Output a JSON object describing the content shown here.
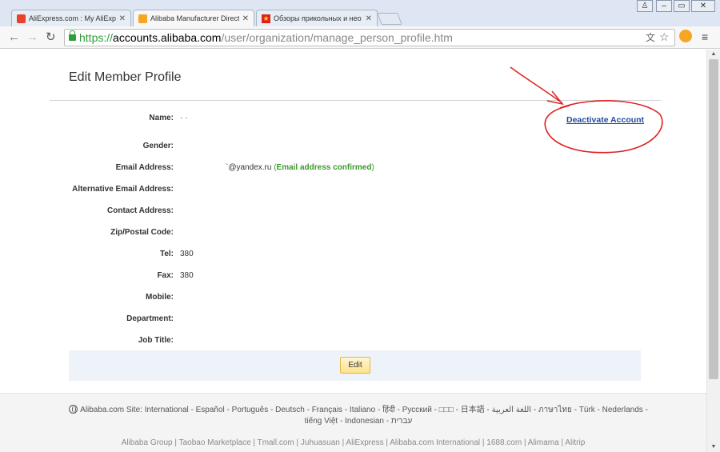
{
  "browser": {
    "tabs": [
      {
        "label": "AliExpress.com : My AliExpr",
        "favicon_color": "#e8412c"
      },
      {
        "label": "Alibaba Manufacturer Direct",
        "favicon_color": "#f5a623"
      },
      {
        "label": "Обзоры прикольных и нео",
        "favicon_color": "#e02020"
      }
    ],
    "url": {
      "scheme": "https://",
      "host": "accounts.alibaba.com",
      "path": "/user/organization/manage_person_profile.htm"
    }
  },
  "page": {
    "title": "Edit Member Profile",
    "deactivate_link": "Deactivate Account",
    "fields": [
      {
        "label": "Name:",
        "value": "·  ·"
      },
      {
        "label": "Gender:",
        "value": ""
      },
      {
        "label": "Email Address:",
        "value": "`@yandex.ru"
      },
      {
        "label": "Alternative Email Address:",
        "value": ""
      },
      {
        "label": "Contact Address:",
        "value": ""
      },
      {
        "label": "Zip/Postal Code:",
        "value": ""
      },
      {
        "label": "Tel:",
        "value": "380"
      },
      {
        "label": "Fax:",
        "value": "380"
      },
      {
        "label": "Mobile:",
        "value": ""
      },
      {
        "label": "Department:",
        "value": ""
      },
      {
        "label": "Job Title:",
        "value": ""
      }
    ],
    "email_status": "Email address confirmed",
    "edit_button": "Edit"
  },
  "footer": {
    "sites_text": "Alibaba.com Site: International - Español - Português - Deutsch - Français - Italiano - हिंदी - Русский - □□□ - 日本語 - اللغة العربية - ภาษาไทย - Türk - Nederlands - tiếng Việt - Indonesian - עברית",
    "group_links": "Alibaba Group | Taobao Marketplace | Tmall.com | Juhuasuan | AliExpress | Alibaba.com International | 1688.com | Alimama | Alitrip"
  },
  "colors": {
    "link": "#224b9e",
    "confirmed": "#3a9a2b",
    "annotation": "#e02020"
  }
}
